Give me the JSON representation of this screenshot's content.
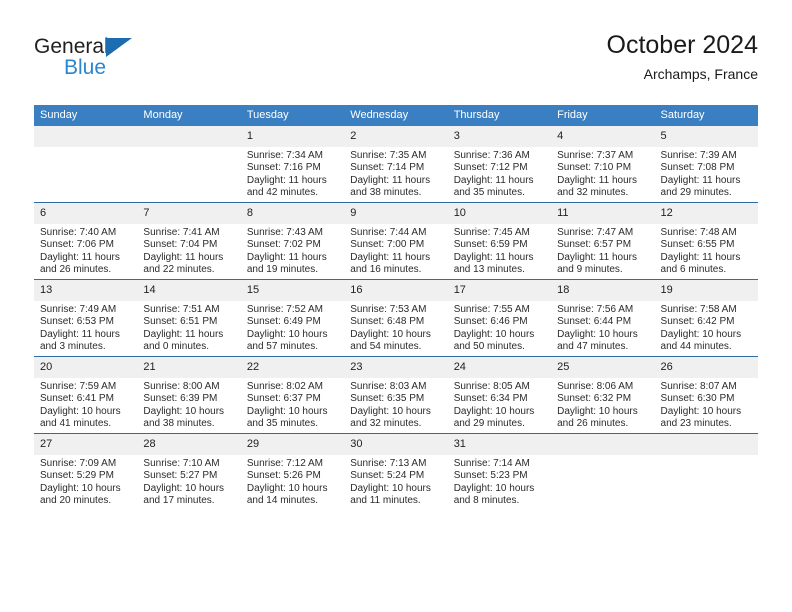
{
  "brand": {
    "name_top": "General",
    "name_bottom": "Blue",
    "triangle_color": "#1b6cb0",
    "blue_text_color": "#2a86d1"
  },
  "header": {
    "title": "October 2024",
    "subtitle": "Archamps, France"
  },
  "theme": {
    "header_bg": "#3a7fc1",
    "row_divider": "#2e6da4",
    "daynum_bg": "#f0f0f0"
  },
  "weekday_headers": [
    "Sunday",
    "Monday",
    "Tuesday",
    "Wednesday",
    "Thursday",
    "Friday",
    "Saturday"
  ],
  "weeks": [
    [
      {
        "day": "",
        "sunrise": "",
        "sunset": "",
        "daylight": "",
        "empty": true
      },
      {
        "day": "",
        "sunrise": "",
        "sunset": "",
        "daylight": "",
        "empty": true
      },
      {
        "day": "1",
        "sunrise": "Sunrise: 7:34 AM",
        "sunset": "Sunset: 7:16 PM",
        "daylight": "Daylight: 11 hours and 42 minutes."
      },
      {
        "day": "2",
        "sunrise": "Sunrise: 7:35 AM",
        "sunset": "Sunset: 7:14 PM",
        "daylight": "Daylight: 11 hours and 38 minutes."
      },
      {
        "day": "3",
        "sunrise": "Sunrise: 7:36 AM",
        "sunset": "Sunset: 7:12 PM",
        "daylight": "Daylight: 11 hours and 35 minutes."
      },
      {
        "day": "4",
        "sunrise": "Sunrise: 7:37 AM",
        "sunset": "Sunset: 7:10 PM",
        "daylight": "Daylight: 11 hours and 32 minutes."
      },
      {
        "day": "5",
        "sunrise": "Sunrise: 7:39 AM",
        "sunset": "Sunset: 7:08 PM",
        "daylight": "Daylight: 11 hours and 29 minutes."
      }
    ],
    [
      {
        "day": "6",
        "sunrise": "Sunrise: 7:40 AM",
        "sunset": "Sunset: 7:06 PM",
        "daylight": "Daylight: 11 hours and 26 minutes."
      },
      {
        "day": "7",
        "sunrise": "Sunrise: 7:41 AM",
        "sunset": "Sunset: 7:04 PM",
        "daylight": "Daylight: 11 hours and 22 minutes."
      },
      {
        "day": "8",
        "sunrise": "Sunrise: 7:43 AM",
        "sunset": "Sunset: 7:02 PM",
        "daylight": "Daylight: 11 hours and 19 minutes."
      },
      {
        "day": "9",
        "sunrise": "Sunrise: 7:44 AM",
        "sunset": "Sunset: 7:00 PM",
        "daylight": "Daylight: 11 hours and 16 minutes."
      },
      {
        "day": "10",
        "sunrise": "Sunrise: 7:45 AM",
        "sunset": "Sunset: 6:59 PM",
        "daylight": "Daylight: 11 hours and 13 minutes."
      },
      {
        "day": "11",
        "sunrise": "Sunrise: 7:47 AM",
        "sunset": "Sunset: 6:57 PM",
        "daylight": "Daylight: 11 hours and 9 minutes."
      },
      {
        "day": "12",
        "sunrise": "Sunrise: 7:48 AM",
        "sunset": "Sunset: 6:55 PM",
        "daylight": "Daylight: 11 hours and 6 minutes."
      }
    ],
    [
      {
        "day": "13",
        "sunrise": "Sunrise: 7:49 AM",
        "sunset": "Sunset: 6:53 PM",
        "daylight": "Daylight: 11 hours and 3 minutes."
      },
      {
        "day": "14",
        "sunrise": "Sunrise: 7:51 AM",
        "sunset": "Sunset: 6:51 PM",
        "daylight": "Daylight: 11 hours and 0 minutes."
      },
      {
        "day": "15",
        "sunrise": "Sunrise: 7:52 AM",
        "sunset": "Sunset: 6:49 PM",
        "daylight": "Daylight: 10 hours and 57 minutes."
      },
      {
        "day": "16",
        "sunrise": "Sunrise: 7:53 AM",
        "sunset": "Sunset: 6:48 PM",
        "daylight": "Daylight: 10 hours and 54 minutes."
      },
      {
        "day": "17",
        "sunrise": "Sunrise: 7:55 AM",
        "sunset": "Sunset: 6:46 PM",
        "daylight": "Daylight: 10 hours and 50 minutes."
      },
      {
        "day": "18",
        "sunrise": "Sunrise: 7:56 AM",
        "sunset": "Sunset: 6:44 PM",
        "daylight": "Daylight: 10 hours and 47 minutes."
      },
      {
        "day": "19",
        "sunrise": "Sunrise: 7:58 AM",
        "sunset": "Sunset: 6:42 PM",
        "daylight": "Daylight: 10 hours and 44 minutes."
      }
    ],
    [
      {
        "day": "20",
        "sunrise": "Sunrise: 7:59 AM",
        "sunset": "Sunset: 6:41 PM",
        "daylight": "Daylight: 10 hours and 41 minutes."
      },
      {
        "day": "21",
        "sunrise": "Sunrise: 8:00 AM",
        "sunset": "Sunset: 6:39 PM",
        "daylight": "Daylight: 10 hours and 38 minutes."
      },
      {
        "day": "22",
        "sunrise": "Sunrise: 8:02 AM",
        "sunset": "Sunset: 6:37 PM",
        "daylight": "Daylight: 10 hours and 35 minutes."
      },
      {
        "day": "23",
        "sunrise": "Sunrise: 8:03 AM",
        "sunset": "Sunset: 6:35 PM",
        "daylight": "Daylight: 10 hours and 32 minutes."
      },
      {
        "day": "24",
        "sunrise": "Sunrise: 8:05 AM",
        "sunset": "Sunset: 6:34 PM",
        "daylight": "Daylight: 10 hours and 29 minutes."
      },
      {
        "day": "25",
        "sunrise": "Sunrise: 8:06 AM",
        "sunset": "Sunset: 6:32 PM",
        "daylight": "Daylight: 10 hours and 26 minutes."
      },
      {
        "day": "26",
        "sunrise": "Sunrise: 8:07 AM",
        "sunset": "Sunset: 6:30 PM",
        "daylight": "Daylight: 10 hours and 23 minutes."
      }
    ],
    [
      {
        "day": "27",
        "sunrise": "Sunrise: 7:09 AM",
        "sunset": "Sunset: 5:29 PM",
        "daylight": "Daylight: 10 hours and 20 minutes."
      },
      {
        "day": "28",
        "sunrise": "Sunrise: 7:10 AM",
        "sunset": "Sunset: 5:27 PM",
        "daylight": "Daylight: 10 hours and 17 minutes."
      },
      {
        "day": "29",
        "sunrise": "Sunrise: 7:12 AM",
        "sunset": "Sunset: 5:26 PM",
        "daylight": "Daylight: 10 hours and 14 minutes."
      },
      {
        "day": "30",
        "sunrise": "Sunrise: 7:13 AM",
        "sunset": "Sunset: 5:24 PM",
        "daylight": "Daylight: 10 hours and 11 minutes."
      },
      {
        "day": "31",
        "sunrise": "Sunrise: 7:14 AM",
        "sunset": "Sunset: 5:23 PM",
        "daylight": "Daylight: 10 hours and 8 minutes."
      },
      {
        "day": "",
        "sunrise": "",
        "sunset": "",
        "daylight": "",
        "empty": true
      },
      {
        "day": "",
        "sunrise": "",
        "sunset": "",
        "daylight": "",
        "empty": true
      }
    ]
  ]
}
